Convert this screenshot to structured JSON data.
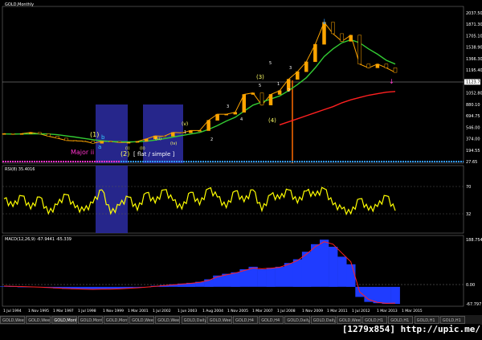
{
  "window": {
    "title": "GOLD,Monthly"
  },
  "labels": {
    "rsi_header": "RSI(8) 35.4016",
    "macd_header": "MACD(12,26,9) -67.9441 -65.339",
    "elliott": [
      "(1)",
      "b",
      "a",
      "Major ii",
      "(2)",
      "[ flat / simple ]",
      "1",
      "2",
      "3",
      "4",
      "5",
      "(3)",
      "(4)",
      "(i)",
      "(ii)",
      "(iii)",
      "(iv)",
      "(v)",
      "3",
      "1",
      "2",
      "5"
    ],
    "watermark": "[1279x854] http://upic.me/"
  },
  "price_axis": [
    "2037.50",
    "1871.30",
    "1705.10",
    "1538.90",
    "1366.30",
    "1195.40",
    "1123.70",
    "1052.80",
    "880.10",
    "694.75",
    "546.00",
    "374.00",
    "194.55",
    "27.65"
  ],
  "rsi_axis": [
    "70",
    "32"
  ],
  "macd_axis": [
    "188.7544",
    "0.00",
    "-67.797"
  ],
  "time_axis": [
    "1 Jul 1994",
    "1 Nov 1995",
    "1 Mar 1997",
    "1 Jul 1998",
    "1 Nov 1999",
    "1 Mar 2001",
    "1 Jul 2002",
    "1 Jun 2003",
    "1 Aug 2004",
    "1 Nov 2005",
    "1 Mar 2007",
    "1 Jul 2008",
    "1 Nov 2009",
    "1 Mar 2011",
    "1 Jul 2012",
    "1 Mar 2013",
    "1 Mar 2015"
  ],
  "tabs": [
    "GOLD,Weekly",
    "GOLD,Weekly",
    "GOLD,Monthly",
    "GOLD,Monthly",
    "GOLD,Monthly",
    "GOLD,Weekly",
    "GOLD,Weekly",
    "GOLD,Daily",
    "GOLD,Weekly",
    "GOLD,H4",
    "GOLD,H4",
    "GOLD,Daily",
    "GOLD,Daily",
    "GOLD,Weekly",
    "GOLD,H1",
    "GOLD,H1",
    "GOLD,H1",
    "GOLD,H1"
  ],
  "colors": {
    "background": "#000000",
    "price_line": "#ffa500",
    "ma_green": "#33cc33",
    "ma_red": "#ff2020",
    "rsi": "#ffff00",
    "macd_hist": "#1f3cff",
    "macd_signal": "#ff2020",
    "highlight": "#2a2a9a",
    "elliott_yellow": "#ffff66",
    "elliott_cyan": "#33ccff",
    "elliott_magenta": "#ff33cc"
  },
  "chart_data": [
    {
      "type": "line",
      "title": "GOLD,Monthly",
      "x": [
        "1994-07",
        "1995-01",
        "1995-07",
        "1996-01",
        "1996-07",
        "1997-01",
        "1997-07",
        "1998-01",
        "1998-07",
        "1999-01",
        "1999-07",
        "2000-01",
        "2000-07",
        "2001-01",
        "2001-07",
        "2002-01",
        "2002-07",
        "2003-01",
        "2003-07",
        "2004-01",
        "2004-07",
        "2005-01",
        "2005-07",
        "2006-01",
        "2006-07",
        "2007-01",
        "2007-07",
        "2008-01",
        "2008-07",
        "2008-10",
        "2009-01",
        "2009-07",
        "2010-01",
        "2010-07",
        "2011-01",
        "2011-07",
        "2011-09",
        "2012-01",
        "2012-07",
        "2013-01",
        "2013-07",
        "2014-01",
        "2014-07",
        "2015-01",
        "2015-03"
      ],
      "series": [
        {
          "values": [
            385,
            376,
            384,
            400,
            382,
            350,
            325,
            295,
            290,
            287,
            258,
            285,
            280,
            268,
            270,
            282,
            315,
            355,
            350,
            400,
            395,
            425,
            425,
            560,
            640,
            640,
            665,
            900,
            920,
            760,
            900,
            950,
            1100,
            1200,
            1330,
            1560,
            1850,
            1700,
            1600,
            1680,
            1300,
            1250,
            1300,
            1250,
            1190
          ]
        },
        {
          "values": [
            380,
            380,
            380,
            382,
            382,
            380,
            370,
            355,
            340,
            322,
            305,
            290,
            282,
            278,
            276,
            278,
            285,
            300,
            318,
            340,
            360,
            380,
            400,
            440,
            490,
            550,
            600,
            680,
            760,
            800,
            840,
            880,
            950,
            1030,
            1120,
            1250,
            1400,
            1500,
            1580,
            1620,
            1580,
            1500,
            1430,
            1350,
            1300
          ]
        },
        {
          "values": [
            null,
            null,
            null,
            null,
            null,
            null,
            null,
            null,
            null,
            null,
            null,
            null,
            null,
            null,
            null,
            null,
            null,
            null,
            null,
            null,
            null,
            null,
            null,
            null,
            null,
            null,
            null,
            null,
            null,
            null,
            null,
            500,
            540,
            580,
            620,
            660,
            700,
            740,
            790,
            830,
            860,
            890,
            910,
            930,
            940
          ]
        }
      ],
      "ylim": [
        27.65,
        2037.5
      ]
    },
    {
      "type": "line",
      "title": "RSI(8) 35.4016",
      "series": [
        {
          "values": [
            55,
            42,
            60,
            38,
            58,
            30,
            45,
            62,
            40,
            35,
            48,
            70,
            30,
            44,
            58,
            36,
            65,
            48,
            70,
            52,
            38,
            66,
            45,
            72,
            58,
            40,
            68,
            50,
            70,
            35,
            62,
            55,
            70,
            48,
            68,
            60,
            72,
            45,
            38,
            30,
            55,
            36,
            42,
            60,
            35
          ]
        }
      ],
      "ylim": [
        0,
        100
      ]
    },
    {
      "type": "bar",
      "title": "MACD(12,26,9) -67.9441 -65.339",
      "series": [
        {
          "values": [
            2,
            1,
            0,
            -1,
            -2,
            -4,
            -6,
            -8,
            -9,
            -10,
            -10,
            -9,
            -8,
            -7,
            -5,
            -3,
            0,
            4,
            7,
            10,
            13,
            16,
            20,
            30,
            45,
            52,
            58,
            70,
            80,
            70,
            76,
            80,
            95,
            110,
            140,
            170,
            188,
            160,
            120,
            90,
            -40,
            -60,
            -65,
            -68,
            -68
          ]
        },
        {
          "values": [
            3,
            2,
            1,
            0,
            -1,
            -3,
            -5,
            -7,
            -8,
            -9,
            -10,
            -9,
            -9,
            -8,
            -6,
            -4,
            -1,
            2,
            5,
            8,
            11,
            14,
            18,
            26,
            40,
            48,
            55,
            65,
            75,
            72,
            74,
            78,
            90,
            105,
            130,
            160,
            180,
            170,
            135,
            100,
            -20,
            -50,
            -62,
            -66,
            -65
          ]
        }
      ],
      "ylim": [
        -67.797,
        188.7544
      ]
    }
  ]
}
